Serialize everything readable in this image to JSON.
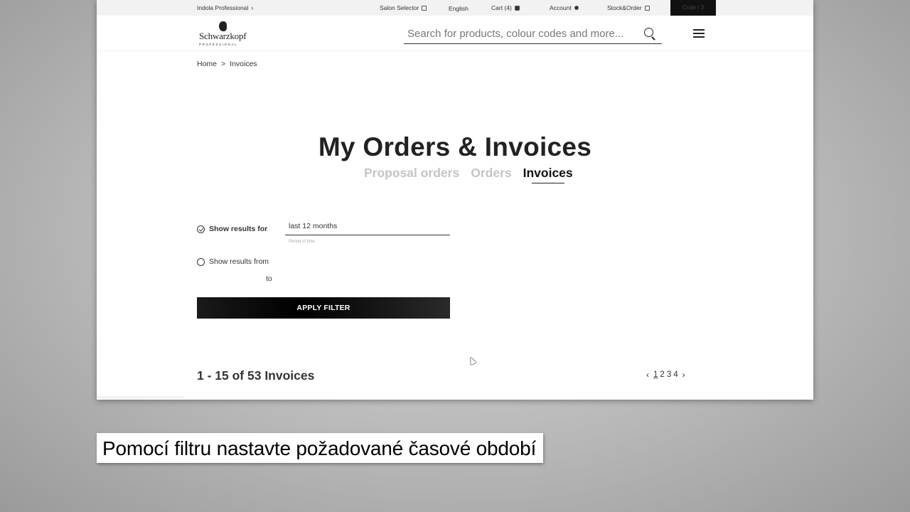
{
  "topbar": {
    "brand_link": "Indola Professional",
    "salon_selector": "Salon Selector",
    "language": "English",
    "cart": "Cart (4)",
    "account": "Account",
    "stock_order": "Stock&Order",
    "code_button": "Code / 3"
  },
  "header": {
    "logo_brand": "Schwarzkopf",
    "logo_sub": "PROFESSIONAL",
    "search_placeholder": "Search for products, colour codes and more..."
  },
  "breadcrumb": {
    "home": "Home",
    "separator": ">",
    "current": "Invoices"
  },
  "page": {
    "title": "My Orders & Invoices",
    "tabs": [
      {
        "label": "Proposal orders",
        "active": false
      },
      {
        "label": "Orders",
        "active": false
      },
      {
        "label": "Invoices",
        "active": true
      }
    ]
  },
  "filter": {
    "option_for_label": "Show results for",
    "period_value": "last 12 months",
    "period_hint": "Period of time",
    "option_from_label": "Show results from",
    "to_label": "to",
    "apply_label": "APPLY FILTER"
  },
  "results": {
    "count_text": "1 - 15 of 53 Invoices",
    "pages": [
      "1",
      "2",
      "3",
      "4"
    ],
    "current_page": "1"
  },
  "caption": {
    "text": "Pomocí filtru nastavte požadované časové období"
  },
  "colors": {
    "accent": "#111111",
    "inactive_tab": "#c4c4c4",
    "topbar_bg": "#f2f2f2"
  }
}
